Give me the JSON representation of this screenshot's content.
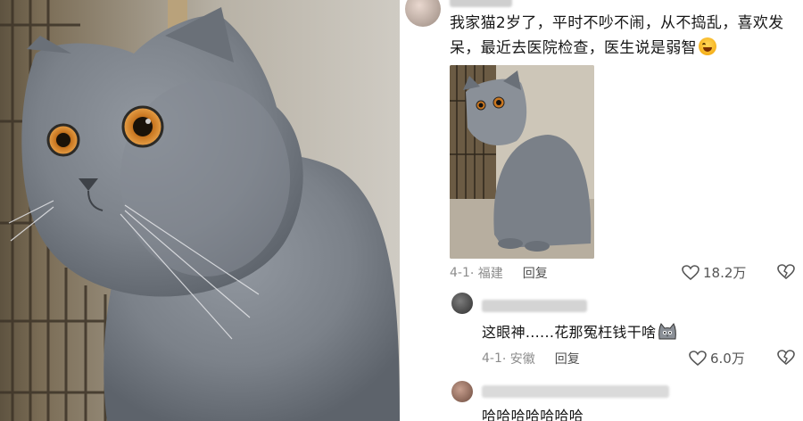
{
  "post": {
    "text": "我家猫2岁了，平时不吵不闹，从不捣乱，喜欢发呆，最近去医院检查，医生说是弱智",
    "emoji": "rofl-emoji",
    "date": "4-1",
    "location": "· 福建",
    "reply_label": "回复",
    "likes": "18.2万"
  },
  "replies": [
    {
      "text": "这眼神......花那冤枉钱干啥",
      "emoji": "cat-emoji",
      "date": "4-1",
      "location": "· 安徽",
      "reply_label": "回复",
      "likes": "6.0万"
    },
    {
      "text": "哈哈哈哈哈哈哈"
    }
  ],
  "colors": {
    "cat_fur": "#7d838a",
    "cat_eye": "#d7862a",
    "meta_text": "#8c8c8c"
  }
}
